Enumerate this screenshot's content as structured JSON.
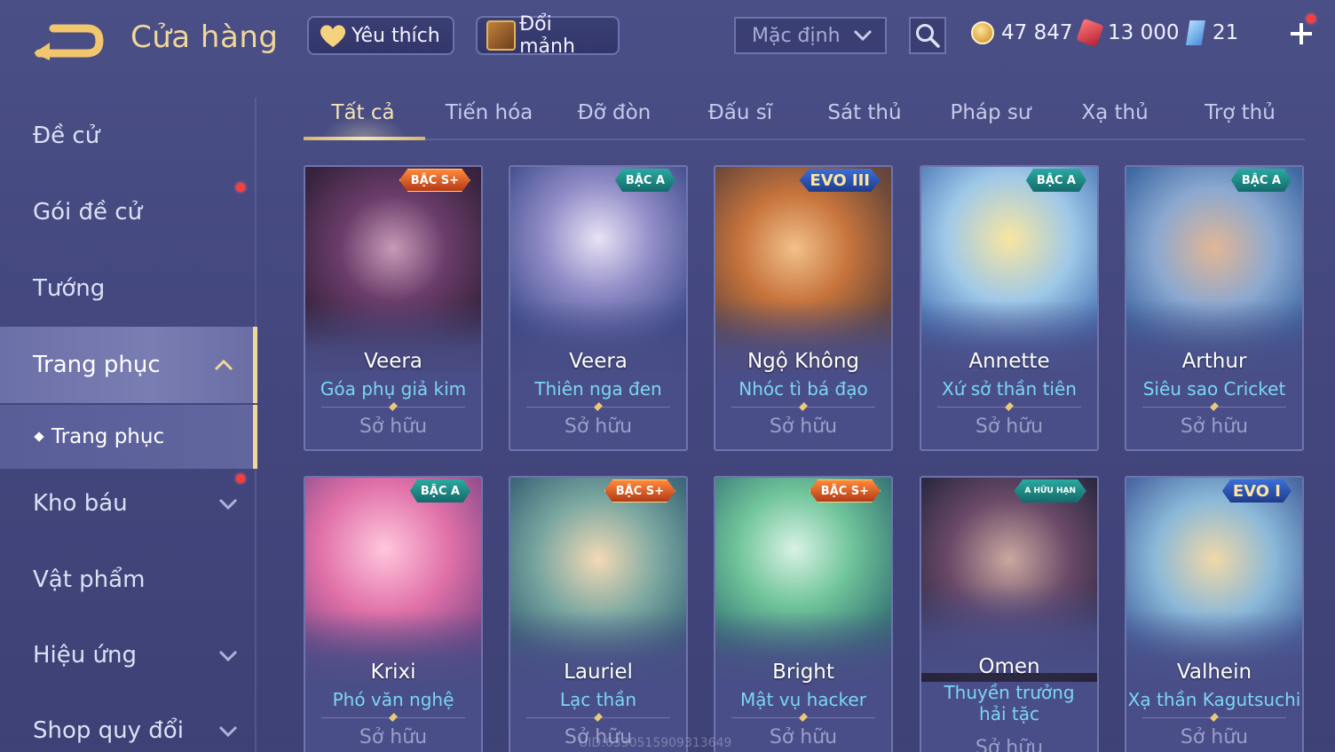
{
  "header": {
    "title": "Cửa hàng",
    "back_icon": "back-arrow-icon",
    "favorite_label": "Yêu thích",
    "exchange_label": "Đổi mảnh",
    "sort_value": "Mặc định",
    "currency": [
      {
        "icon": "gold-coin-icon",
        "value": "47 847"
      },
      {
        "icon": "ruby-icon",
        "value": "13 000"
      },
      {
        "icon": "gem-icon",
        "value": "21"
      }
    ]
  },
  "sidebar": {
    "items": [
      {
        "label": "Đề cử"
      },
      {
        "label": "Gói đề cử"
      },
      {
        "label": "Tướng"
      },
      {
        "label": "Trang phục"
      },
      {
        "label": "Trang phục"
      },
      {
        "label": "Kho báu"
      },
      {
        "label": "Vật phẩm"
      },
      {
        "label": "Hiệu ứng"
      },
      {
        "label": "Shop quy đổi"
      }
    ]
  },
  "tabs": [
    "Tất cả",
    "Tiến hóa",
    "Đỡ đòn",
    "Đấu sĩ",
    "Sát thủ",
    "Pháp sư",
    "Xạ thủ",
    "Trợ thủ"
  ],
  "cards": [
    {
      "hero": "Veera",
      "skin": "Góa phụ giả kim",
      "status": "Sở hữu",
      "badge": "BẬC S+"
    },
    {
      "hero": "Veera",
      "skin": "Thiên nga đen",
      "status": "Sở hữu",
      "badge": "BẬC A"
    },
    {
      "hero": "Ngộ Không",
      "skin": "Nhóc tì bá đạo",
      "status": "Sở hữu",
      "badge": "EVO III"
    },
    {
      "hero": "Annette",
      "skin": "Xứ sở thần tiên",
      "status": "Sở hữu",
      "badge": "BẬC A"
    },
    {
      "hero": "Arthur",
      "skin": "Siêu sao Cricket",
      "status": "Sở hữu",
      "badge": "BẬC A"
    },
    {
      "hero": "Krixi",
      "skin": "Phó văn nghệ",
      "status": "Sở hữu",
      "badge": "BẬC A"
    },
    {
      "hero": "Lauriel",
      "skin": "Lạc thần",
      "status": "Sở hữu",
      "badge": "BẬC S+"
    },
    {
      "hero": "Bright",
      "skin": "Mật vụ hacker",
      "status": "Sở hữu",
      "badge": "BẬC S+"
    },
    {
      "hero": "Omen",
      "skin": "Thuyền trưởng hải tặc",
      "status": "Sở hữu",
      "badge": "A HỮU HẠN"
    },
    {
      "hero": "Valhein",
      "skin": "Xạ thần Kagutsuchi",
      "status": "Sở hữu",
      "badge": "EVO I"
    }
  ],
  "footer": {
    "uid": "UID:6330515909313649"
  },
  "colors": {
    "accent_gold": "#f1d79a",
    "skin_name": "#7ad6f2",
    "background": "#474b82"
  }
}
